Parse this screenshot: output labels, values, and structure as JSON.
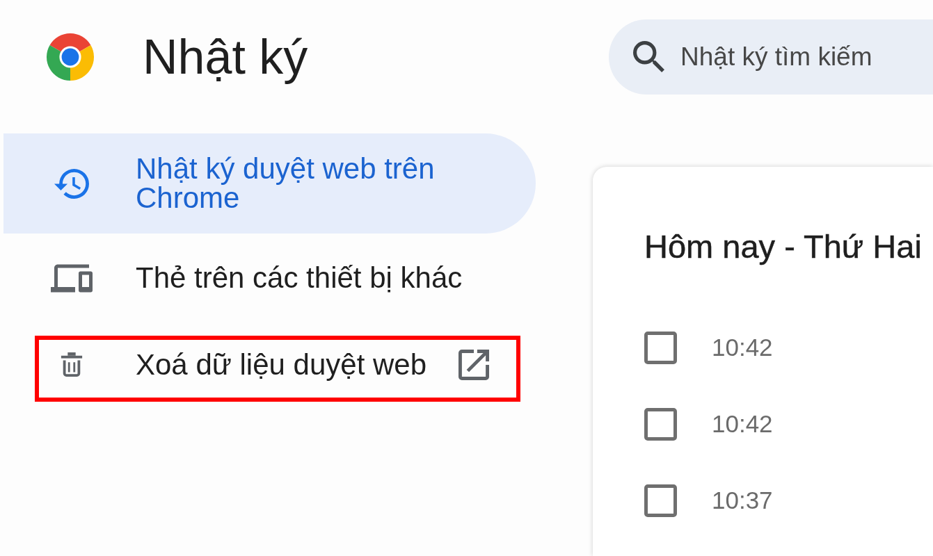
{
  "header": {
    "title": "Nhật ký"
  },
  "search": {
    "placeholder": "Nhật ký tìm kiếm"
  },
  "sidebar": {
    "items": [
      {
        "label": "Nhật ký duyệt web trên Chrome",
        "selected": true,
        "external": false,
        "highlighted": false
      },
      {
        "label": "Thẻ trên các thiết bị khác",
        "selected": false,
        "external": false,
        "highlighted": false
      },
      {
        "label": "Xoá dữ liệu duyệt web",
        "selected": false,
        "external": true,
        "highlighted": true
      }
    ]
  },
  "history": {
    "heading": "Hôm nay - Thứ Hai",
    "entries": [
      {
        "checked": false,
        "time": "10:42"
      },
      {
        "checked": false,
        "time": "10:42"
      },
      {
        "checked": false,
        "time": "10:37"
      }
    ]
  }
}
